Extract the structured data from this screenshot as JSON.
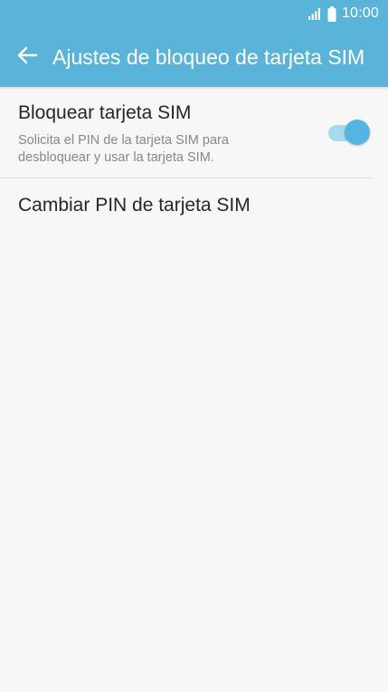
{
  "status_bar": {
    "time": "10:00",
    "signal_icon": "signal-icon",
    "battery_icon": "battery-icon"
  },
  "header": {
    "back_icon": "arrow-left-icon",
    "title": "Ajustes de bloqueo de tarjeta SIM"
  },
  "settings": {
    "lock_sim": {
      "title": "Bloquear tarjeta SIM",
      "summary": "Solicita el PIN de la tarjeta SIM para desbloquear y usar la tarjeta SIM.",
      "enabled": true
    },
    "change_pin": {
      "title": "Cambiar PIN de tarjeta SIM"
    }
  },
  "colors": {
    "appbar": "#5ab3d8",
    "toggle_thumb": "#54b5e2",
    "toggle_track": "#a9d9ef",
    "background": "#f7f7f7"
  }
}
